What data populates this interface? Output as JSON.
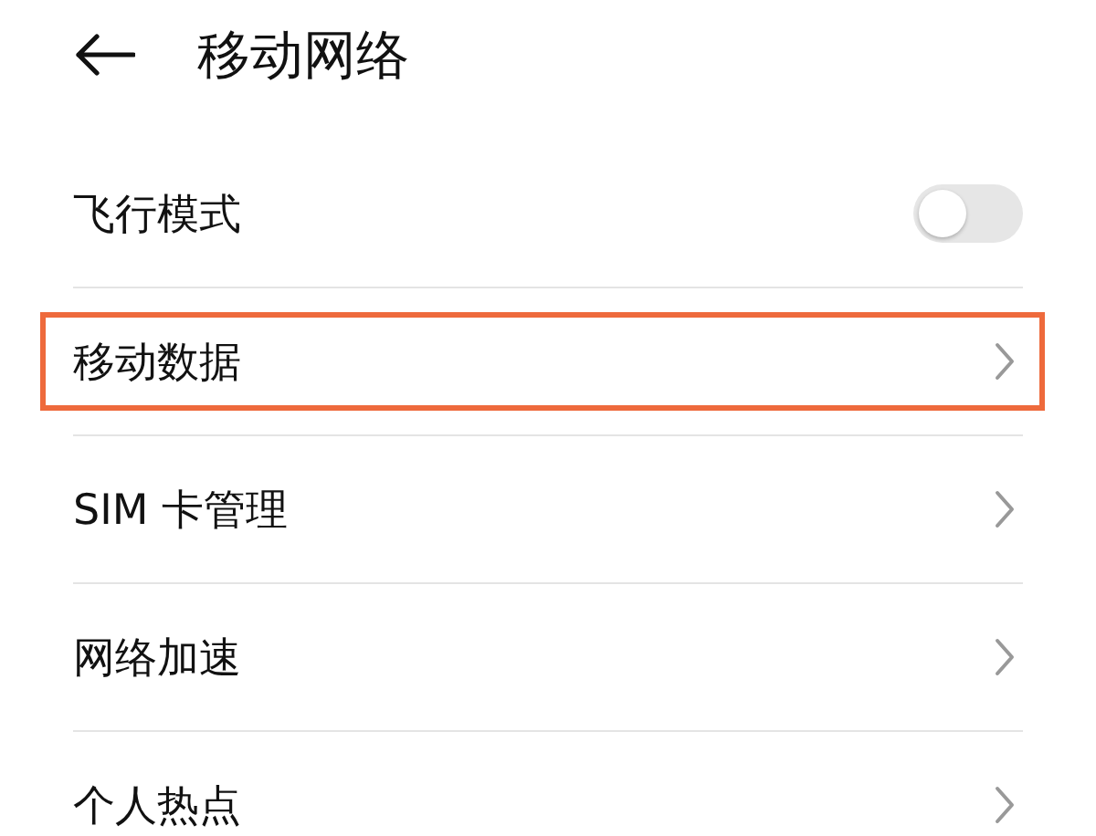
{
  "header": {
    "title": "移动网络"
  },
  "items": [
    {
      "kind": "toggle",
      "label": "飞行模式",
      "on": false,
      "highlighted": false
    },
    {
      "kind": "link",
      "label": "移动数据",
      "highlighted": true
    },
    {
      "kind": "link",
      "label": "SIM 卡管理",
      "highlighted": false
    },
    {
      "kind": "link",
      "label": "网络加速",
      "highlighted": false
    },
    {
      "kind": "link",
      "label": "个人热点",
      "highlighted": false
    }
  ]
}
